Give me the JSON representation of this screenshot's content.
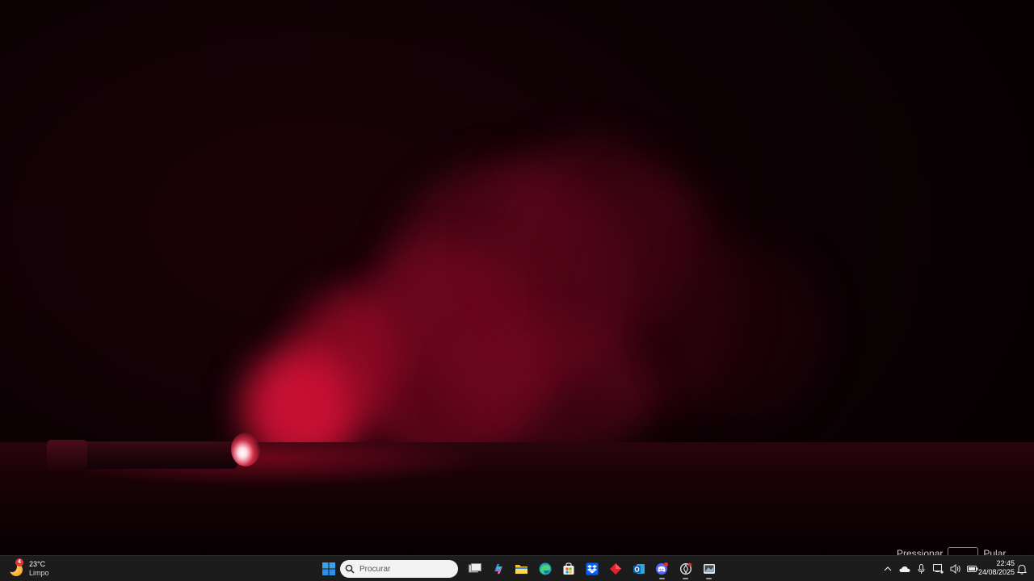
{
  "desktop": {
    "hint_left": "Pressionar",
    "hint_right": "Pular"
  },
  "taskbar": {
    "weather": {
      "temperature": "23°C",
      "condition": "Limpo",
      "badge": "4",
      "icon": "moon-weather-icon"
    },
    "search": {
      "placeholder": "Procurar"
    },
    "pinned": [
      {
        "name": "task-view",
        "icon": "task-view-icon"
      },
      {
        "name": "copilot",
        "icon": "copilot-icon"
      },
      {
        "name": "file-explorer",
        "icon": "folder-icon"
      },
      {
        "name": "edge",
        "icon": "edge-icon"
      },
      {
        "name": "microsoft-store",
        "icon": "store-icon"
      },
      {
        "name": "dropbox",
        "icon": "dropbox-icon"
      },
      {
        "name": "red-app",
        "icon": "diamond-icon"
      },
      {
        "name": "outlook",
        "icon": "outlook-icon"
      },
      {
        "name": "discord",
        "icon": "discord-icon",
        "badge": "1"
      },
      {
        "name": "chatgpt",
        "icon": "chatgpt-icon"
      },
      {
        "name": "photos",
        "icon": "image-app-icon"
      }
    ],
    "tray": {
      "time": "22:45",
      "date": "24/08/2025"
    }
  }
}
